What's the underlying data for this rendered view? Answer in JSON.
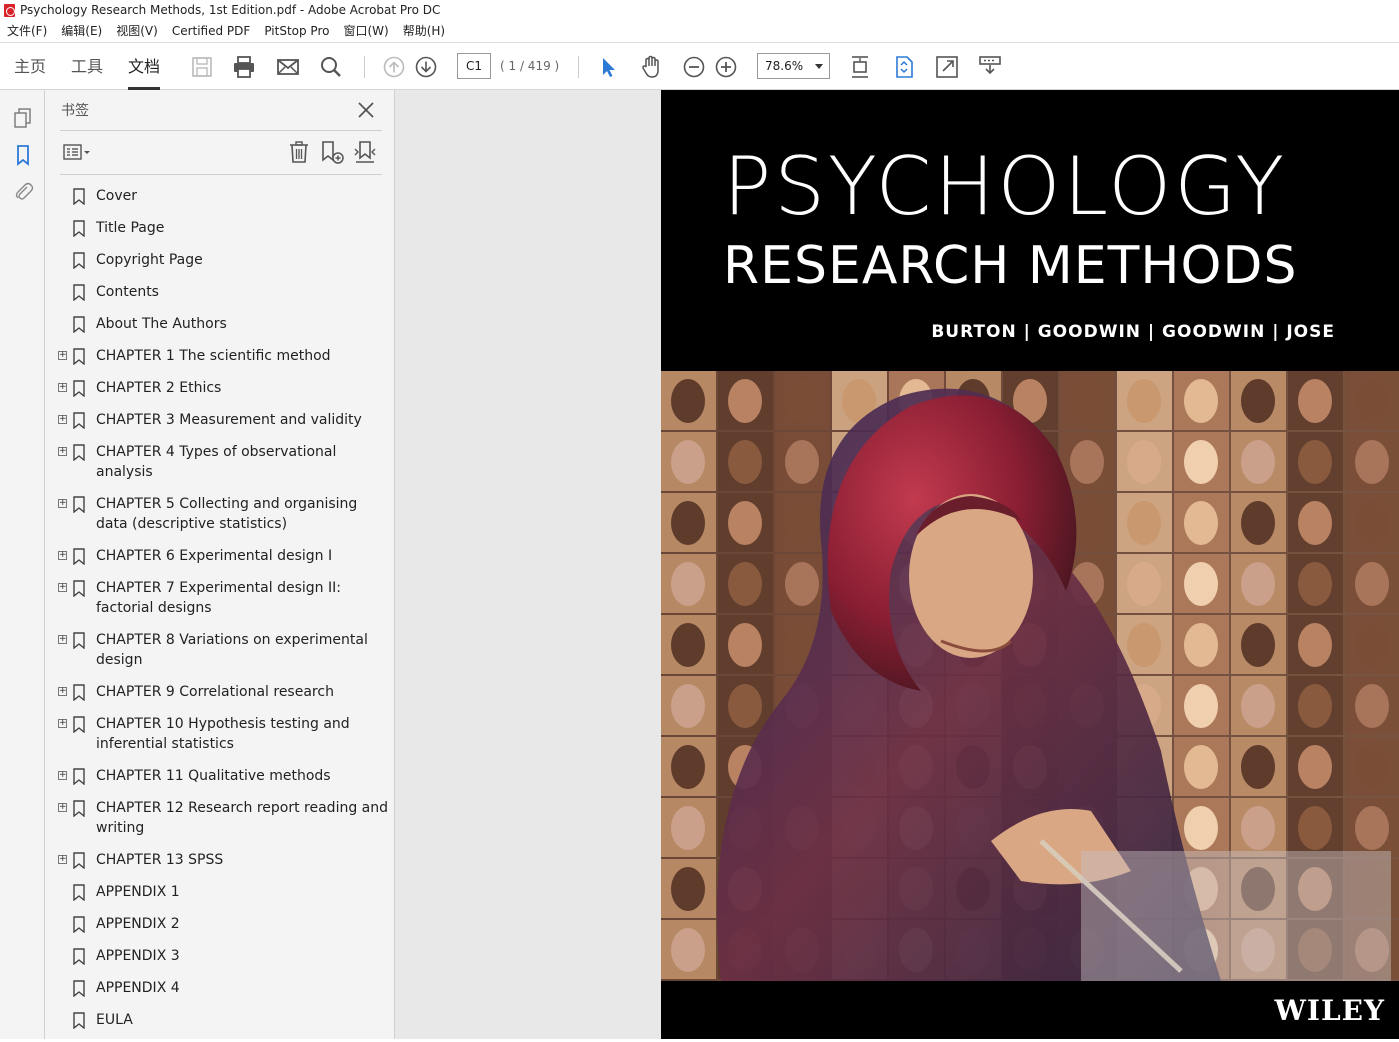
{
  "window": {
    "title": "Psychology Research Methods, 1st Edition.pdf - Adobe Acrobat Pro DC"
  },
  "menu": [
    "文件(F)",
    "编辑(E)",
    "视图(V)",
    "Certified PDF",
    "PitStop Pro",
    "窗口(W)",
    "帮助(H)"
  ],
  "tabs": {
    "home": "主页",
    "tools": "工具",
    "document": "文档"
  },
  "navigation": {
    "current_page": "C1",
    "page_count": "( 1 / 419 )",
    "zoom": "78.6%"
  },
  "bookmarks_panel": {
    "title": "书签",
    "items": [
      {
        "label": "Cover",
        "expandable": false
      },
      {
        "label": "Title Page",
        "expandable": false
      },
      {
        "label": "Copyright Page",
        "expandable": false
      },
      {
        "label": "Contents",
        "expandable": false
      },
      {
        "label": "About The Authors",
        "expandable": false
      },
      {
        "label": "CHAPTER 1 The scientific method",
        "expandable": true
      },
      {
        "label": "CHAPTER 2 Ethics",
        "expandable": true
      },
      {
        "label": "CHAPTER 3 Measurement and validity",
        "expandable": true
      },
      {
        "label": "CHAPTER 4 Types of observational analysis",
        "expandable": true
      },
      {
        "label": "CHAPTER 5 Collecting and organising data (descriptive statistics)",
        "expandable": true
      },
      {
        "label": "CHAPTER 6 Experimental design I",
        "expandable": true
      },
      {
        "label": "CHAPTER 7 Experimental design II: factorial designs",
        "expandable": true
      },
      {
        "label": "CHAPTER 8 Variations on experimental design",
        "expandable": true
      },
      {
        "label": "CHAPTER 9 Correlational research",
        "expandable": true
      },
      {
        "label": "CHAPTER 10 Hypothesis testing and inferential statistics",
        "expandable": true
      },
      {
        "label": "CHAPTER 11 Qualitative methods",
        "expandable": true
      },
      {
        "label": "CHAPTER 12 Research report reading and writing",
        "expandable": true
      },
      {
        "label": "CHAPTER 13 SPSS",
        "expandable": true
      },
      {
        "label": "APPENDIX 1",
        "expandable": false
      },
      {
        "label": "APPENDIX 2",
        "expandable": false
      },
      {
        "label": "APPENDIX 3",
        "expandable": false
      },
      {
        "label": "APPENDIX 4",
        "expandable": false
      },
      {
        "label": "EULA",
        "expandable": false
      }
    ]
  },
  "cover": {
    "title": "PSYCHOLOGY",
    "subtitle": "RESEARCH METHODS",
    "authors": "BURTON | GOODWIN | GOODWIN | JOSE",
    "publisher": "WILEY"
  },
  "colors": {
    "accent_blue": "#2d7ad6",
    "icon_gray": "#555555",
    "cover_bg": "#000000"
  }
}
